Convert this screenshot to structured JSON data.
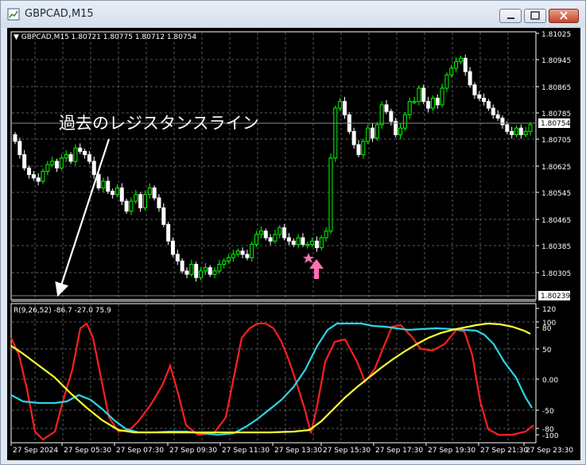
{
  "window": {
    "title": "GBPCAD,M15"
  },
  "main_chart": {
    "info": "▼ GBPCAD,M15  1.80721 1.80775 1.80712 1.80754",
    "annotation": "過去のレジスタンスライン",
    "current_price_label": "1.80754",
    "support_price_label": "1.80239",
    "price_ticks": [
      "1.81025",
      "1.80945",
      "1.80865",
      "1.80785",
      "1.80705",
      "1.80625",
      "1.80545",
      "1.80465",
      "1.80385",
      "1.80305"
    ],
    "colors": {
      "bull": "#00ff00",
      "bear": "#ffffff",
      "grid": "#5a5a5a",
      "star": "#ff6fae"
    }
  },
  "indicator": {
    "info": "R(9,26,52) -86.7 -27.0 75.9",
    "scale_ticks": [
      "120",
      "100",
      "80",
      "50",
      "0.00",
      "-50",
      "-80",
      "-100"
    ],
    "series_colors": {
      "fast": "#ff2020",
      "mid": "#29d6e6",
      "slow": "#ffff33"
    }
  },
  "time_axis": [
    "27 Sep 2024",
    "27 Sep 05:30",
    "27 Sep 07:30",
    "27 Sep 09:30",
    "27 Sep 11:30",
    "27 Sep 13:30",
    "27 Sep 15:30",
    "27 Sep 17:30",
    "27 Sep 19:30",
    "27 Sep 21:30",
    "27 Sep 23:30"
  ]
}
